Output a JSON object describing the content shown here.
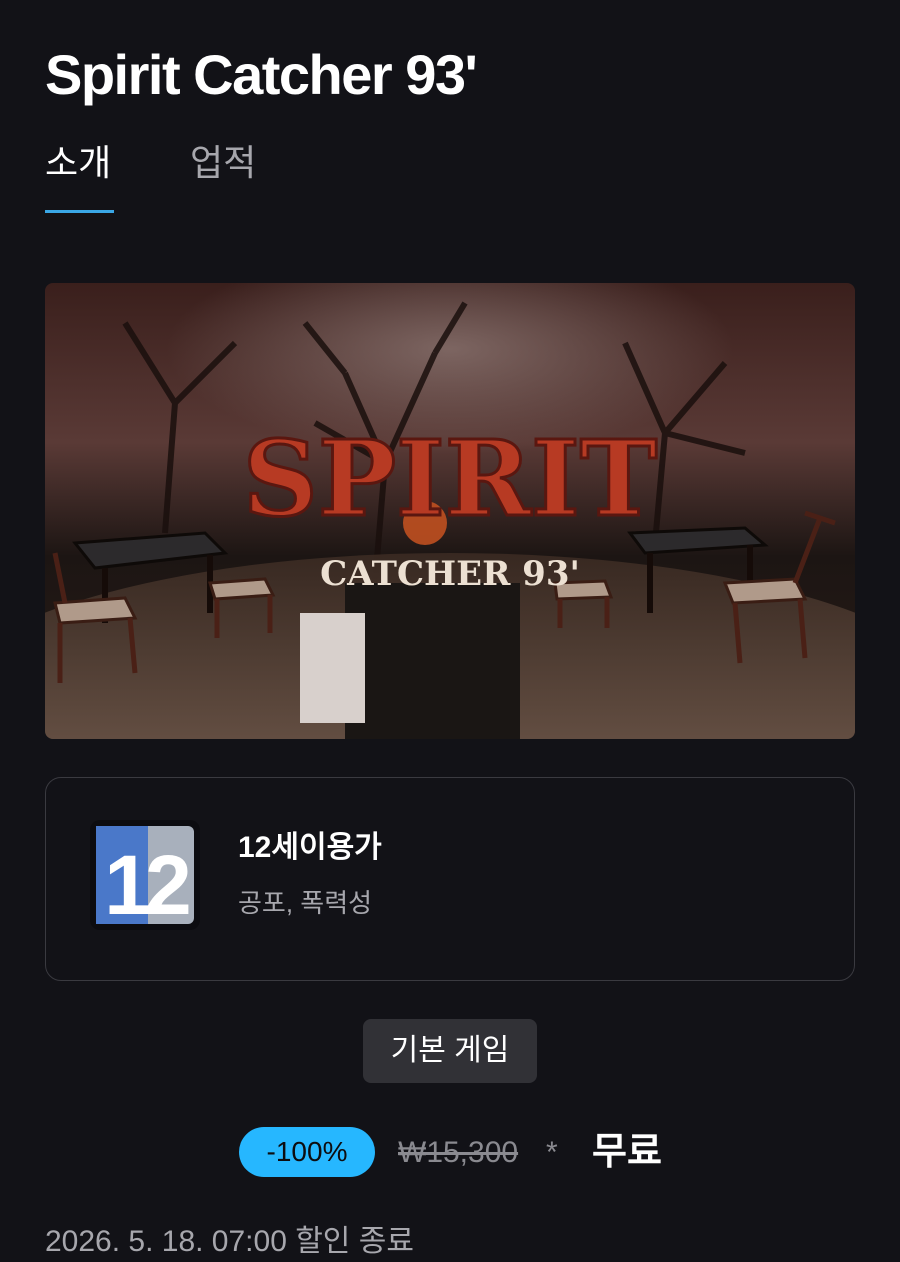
{
  "game": {
    "title": "Spirit Catcher 93'"
  },
  "tabs": [
    {
      "label": "소개",
      "active": true
    },
    {
      "label": "업적",
      "active": false
    }
  ],
  "hero": {
    "logo_line1": "SPIRIT",
    "logo_line2": "CATCHER 93'"
  },
  "rating": {
    "badge": "12",
    "name": "12세이용가",
    "descriptors": "공포, 폭력성"
  },
  "base_game_label": "기본 게임",
  "price": {
    "discount": "-100%",
    "original": "₩15,300",
    "asterisk": "*",
    "final": "무료"
  },
  "sale_end": "2026. 5. 18. 07:00 할인 종료",
  "colors": {
    "background": "#121217",
    "accent": "#3aa7e6",
    "discount_badge": "#26b7ff",
    "rating_blue": "#4a78c9",
    "logo_red": "#b73a23"
  }
}
